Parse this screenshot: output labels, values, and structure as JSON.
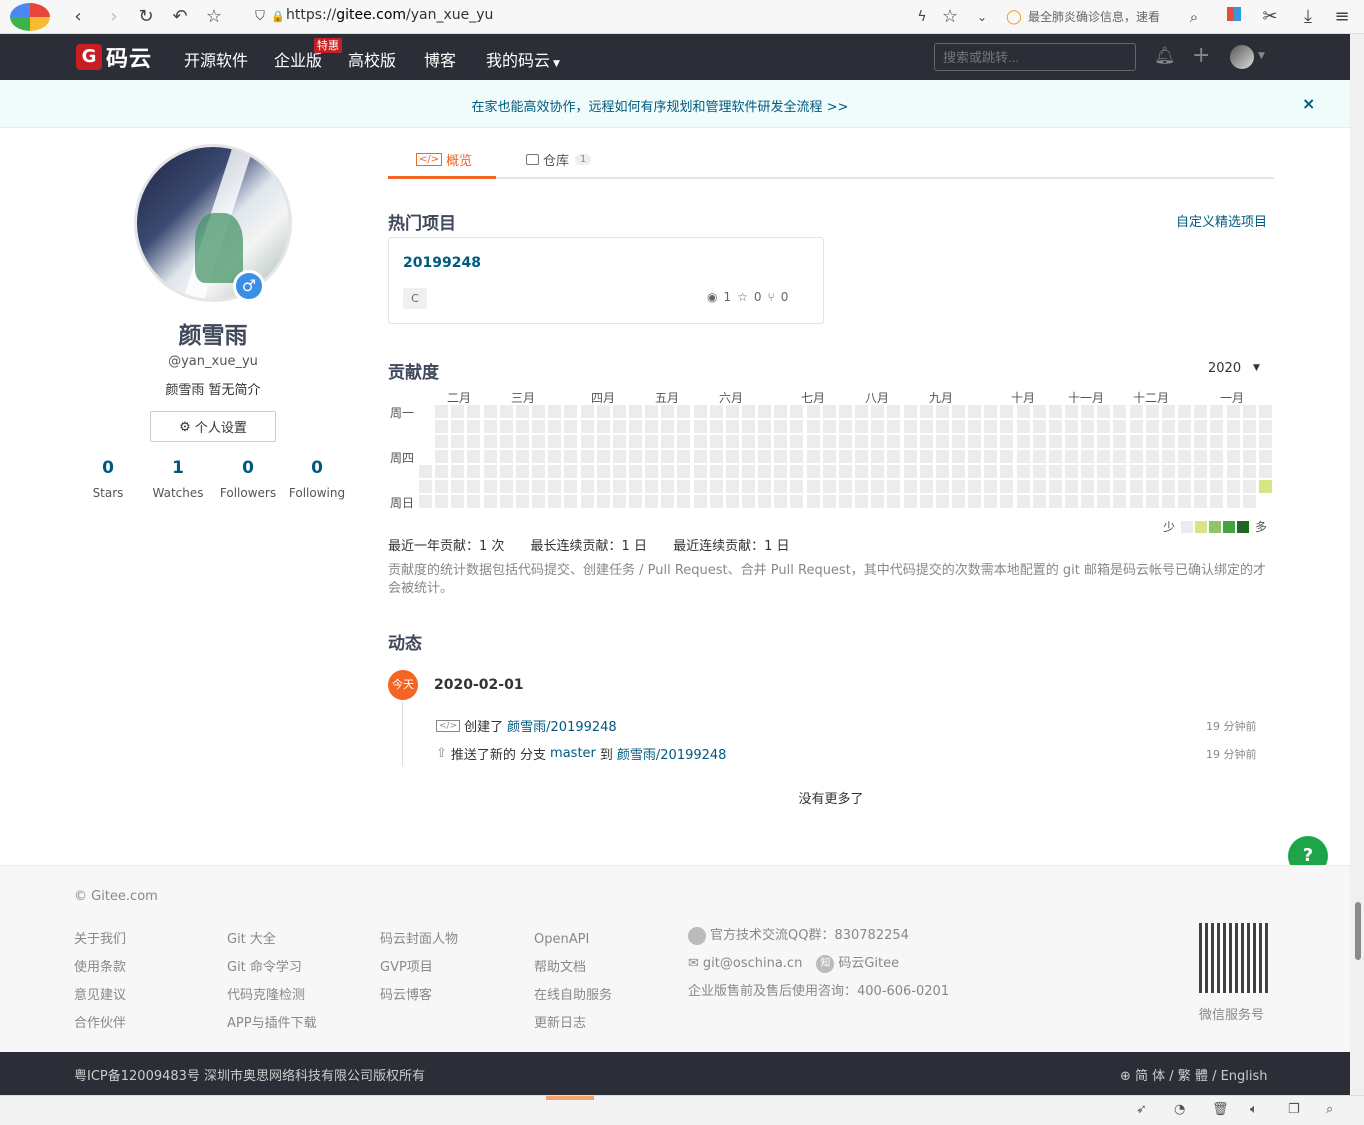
{
  "browser": {
    "url_scheme": "https://",
    "url_domain": "gitee.com",
    "url_path": "/yan_xue_yu",
    "news": "最全肺炎确诊信息，速看"
  },
  "header": {
    "logo_letter": "G",
    "logo_text": "码云",
    "nav": [
      "开源软件",
      "企业版",
      "高校版",
      "博客",
      "我的码云"
    ],
    "nav_badge": "特惠",
    "search_placeholder": "搜索或跳转..."
  },
  "notice": {
    "text": "在家也能高效协作，远程如何有序规划和管理软件研发全流程 >>",
    "close": "×"
  },
  "profile": {
    "name": "颜雪雨",
    "handle": "@yan_xue_yu",
    "bio": "颜雪雨 暂无简介",
    "settings_label": "个人设置",
    "stats": [
      {
        "value": "0",
        "label": "Stars"
      },
      {
        "value": "1",
        "label": "Watches"
      },
      {
        "value": "0",
        "label": "Followers"
      },
      {
        "value": "0",
        "label": "Following"
      }
    ]
  },
  "tabs": {
    "overview": "概览",
    "repos": "仓库",
    "repos_count": "1"
  },
  "popular": {
    "title": "热门项目",
    "customize": "自定义精选项目",
    "project": {
      "name": "20199248",
      "lang": "C",
      "watch": "1",
      "star": "0",
      "fork": "0"
    }
  },
  "contrib": {
    "title": "贡献度",
    "year": "2020",
    "months": [
      "二月",
      "三月",
      "四月",
      "五月",
      "六月",
      "七月",
      "八月",
      "九月",
      "十月",
      "十一月",
      "十二月",
      "一月"
    ],
    "weekdays": [
      "周一",
      "周四",
      "周日"
    ],
    "legend_less": "少",
    "legend_more": "多",
    "legend_colors": [
      "#ececec",
      "#d6e685",
      "#8cc665",
      "#44a340",
      "#1e6823"
    ],
    "last_year": "最近一年贡献：1 次",
    "longest": "最长连续贡献：1 日",
    "recent": "最近连续贡献：1 日",
    "note": "贡献度的统计数据包括代码提交、创建任务 / Pull Request、合并 Pull Request，其中代码提交的次数需本地配置的 git 邮箱是码云帐号已确认绑定的才会被统计。"
  },
  "activity": {
    "title": "动态",
    "today": "今天",
    "date": "2020-02-01",
    "items": [
      {
        "prefix": "创建了",
        "link": "颜雪雨/20199248",
        "middle": "",
        "link2": "",
        "time": "19 分钟前"
      },
      {
        "prefix": "推送了新的 分支",
        "link": "master",
        "middle": "到",
        "link2": "颜雪雨/20199248",
        "time": "19 分钟前"
      }
    ],
    "no_more": "没有更多了"
  },
  "footer": {
    "copyright": "© Gitee.com",
    "col1": [
      "关于我们",
      "使用条款",
      "意见建议",
      "合作伙伴"
    ],
    "col2": [
      "Git 大全",
      "Git 命令学习",
      "代码克隆检测",
      "APP与插件下载"
    ],
    "col3": [
      "码云封面人物",
      "GVP项目",
      "码云博客"
    ],
    "col4": [
      "OpenAPI",
      "帮助文档",
      "在线自助服务",
      "更新日志"
    ],
    "qq": "官方技术交流QQ群：830782254",
    "email": "git@oschina.cn",
    "zhihu": "码云Gitee",
    "sales": "企业版售前及售后使用咨询：400-606-0201",
    "wechat": "微信服务号",
    "icp": "粤ICP备12009483号 深圳市奥思网络科技有限公司版权所有",
    "lang": "简 体 / 繁 體 / English"
  },
  "float": {
    "help": "?"
  }
}
